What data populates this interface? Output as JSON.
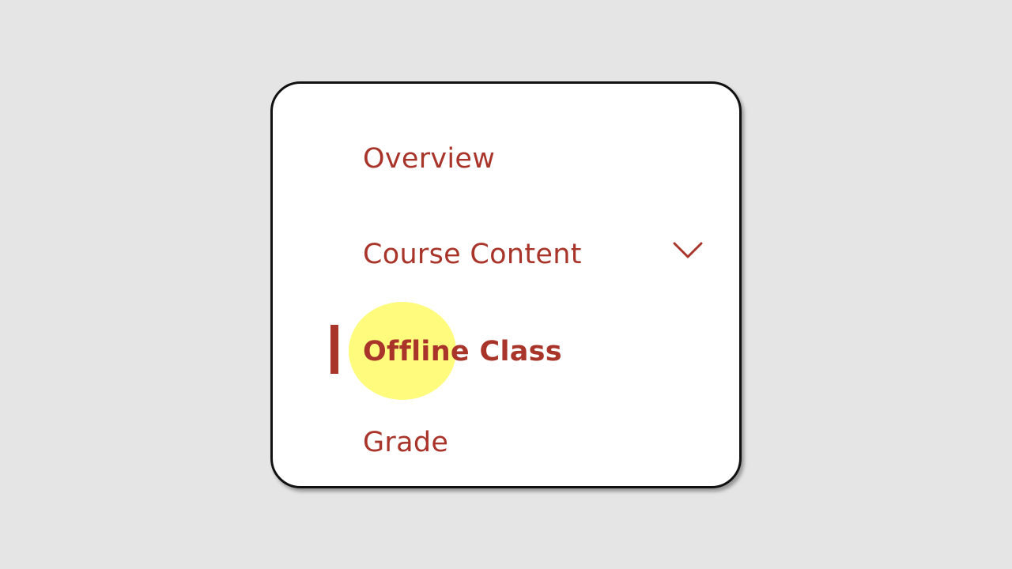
{
  "menu": {
    "items": [
      {
        "label": "Overview"
      },
      {
        "label": "Course Content",
        "icon": "chevron-down-icon"
      },
      {
        "label_part1": "Offline",
        "label_part2": "Class",
        "active": true
      },
      {
        "label": "Grade"
      }
    ]
  },
  "colors": {
    "accent": "#a8342a",
    "highlight": "#fffa50",
    "background": "#e5e5e5",
    "card": "#ffffff"
  }
}
